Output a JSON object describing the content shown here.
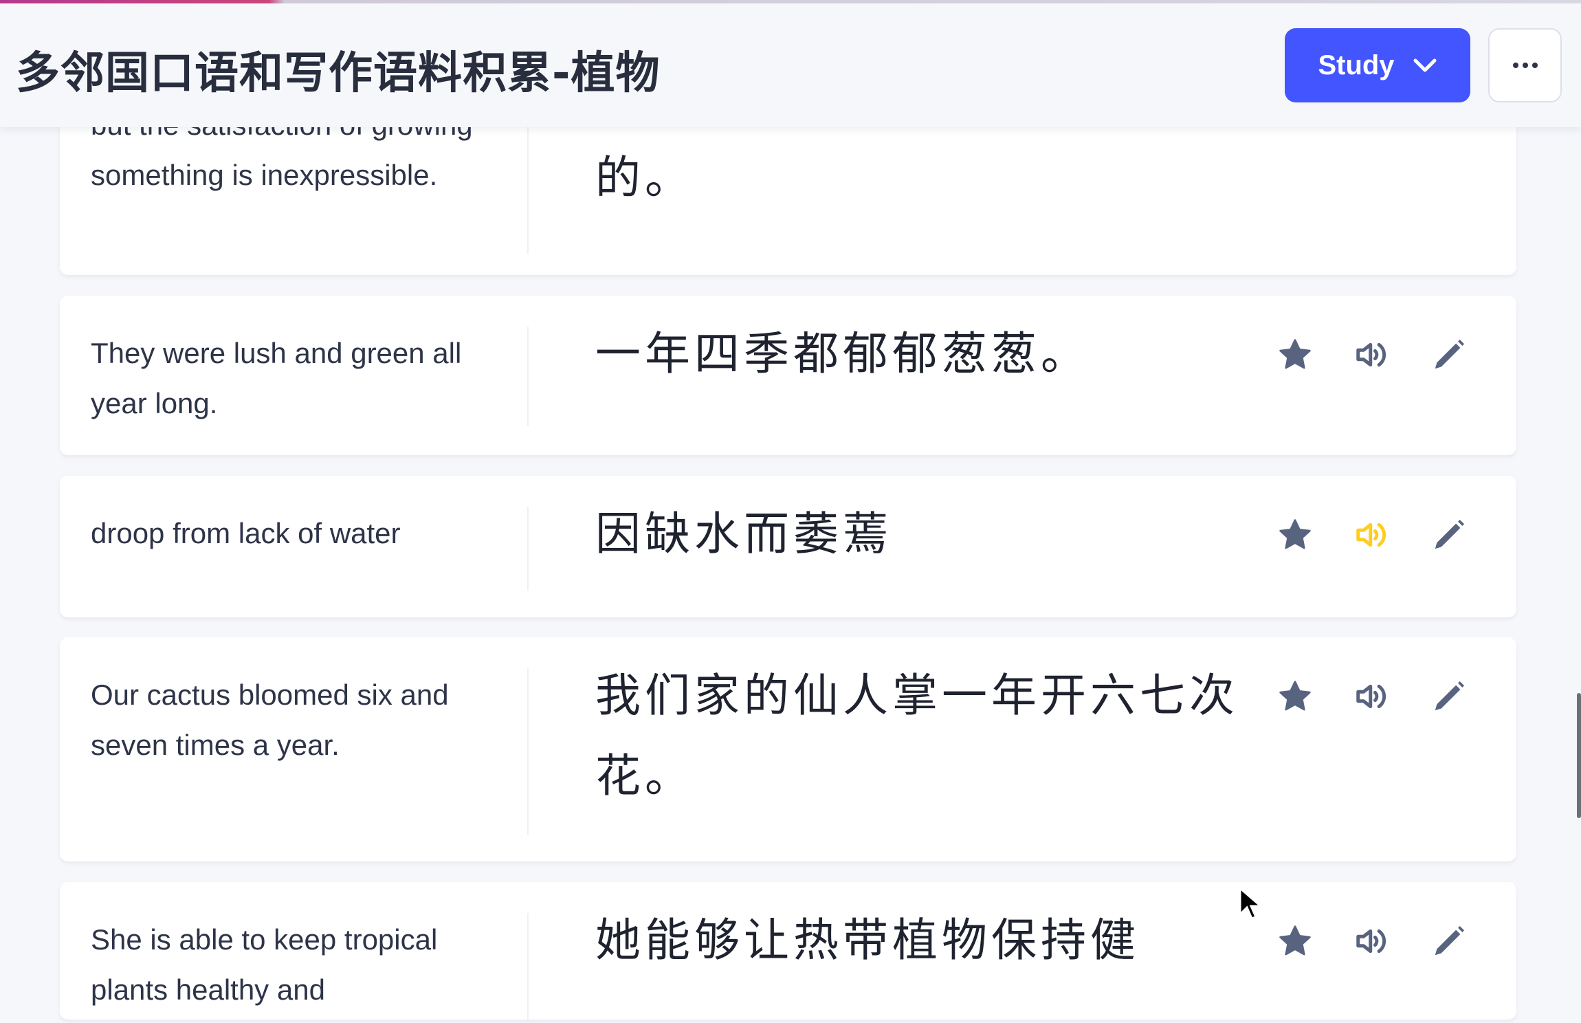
{
  "header": {
    "title": "多邻国口语和写作语料积累-植物",
    "study_label": "Study",
    "study_icon": "chevron-down-icon",
    "more_icon": "ellipsis-icon"
  },
  "colors": {
    "accent": "#4255ff",
    "icon": "#586380",
    "audio_active": "#ffcd1f"
  },
  "cards": [
    {
      "term": "but the satisfaction of growing something is inexpressible.",
      "definition": "的。",
      "audio_active": false
    },
    {
      "term": "They were lush and green all year long.",
      "definition": "一年四季都郁郁葱葱。",
      "audio_active": false
    },
    {
      "term": "droop from lack of water",
      "definition": "因缺水而萎蔫",
      "audio_active": true
    },
    {
      "term": "Our cactus bloomed six and seven times a year.",
      "definition": "我们家的仙人掌一年开六七次花。",
      "audio_active": false
    },
    {
      "term": "She is able to keep tropical plants healthy and",
      "definition": "她能够让热带植物保持健",
      "audio_active": false
    }
  ]
}
